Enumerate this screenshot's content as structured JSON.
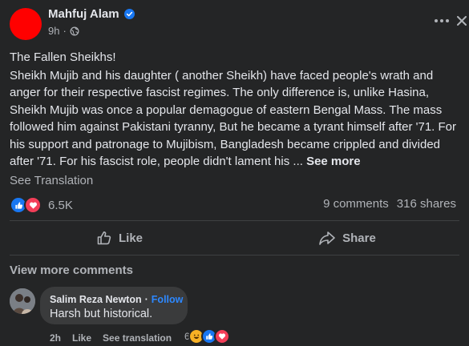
{
  "post": {
    "author": "Mahfuj Alam",
    "time": "9h",
    "separator": "·",
    "title": "The Fallen Sheikhs!",
    "body": "Sheikh Mujib and his daughter ( another Sheikh) have faced people's wrath and anger for their respective fascist regimes. The only difference is, unlike Hasina, Sheikh Mujib was once a popular demagogue of eastern Bengal Mass. The mass followed him against Pakistani tyranny, But he became a tyrant himself after '71. For his support and patronage to Mujibism, Bangladesh became crippled and divided after '71. For his fascist role, people didn't lament his ...",
    "see_more": "See more",
    "see_translation": "See Translation",
    "reaction_count": "6.5K",
    "comments": "9 comments",
    "shares": "316 shares",
    "icons": {
      "verified": "verified-badge-icon",
      "privacy": "globe-icon",
      "more": "more-options-icon",
      "close": "close-icon"
    }
  },
  "actions": {
    "like": "Like",
    "share": "Share"
  },
  "comments_section": {
    "view_more": "View more comments",
    "comment": {
      "author": "Salim Reza Newton",
      "follow_sep": "·",
      "follow": "Follow",
      "text": "Harsh but historical.",
      "time": "2h",
      "like": "Like",
      "see_translation": "See translation",
      "reaction_count": "6"
    }
  },
  "colors": {
    "background": "#242526",
    "text": "#e4e6eb",
    "secondary": "#b0b3b8",
    "link": "#2d88ff",
    "like": "#1877f2",
    "love": "#f33e58",
    "haha": "#f7b125",
    "avatar": "#ff0000"
  }
}
